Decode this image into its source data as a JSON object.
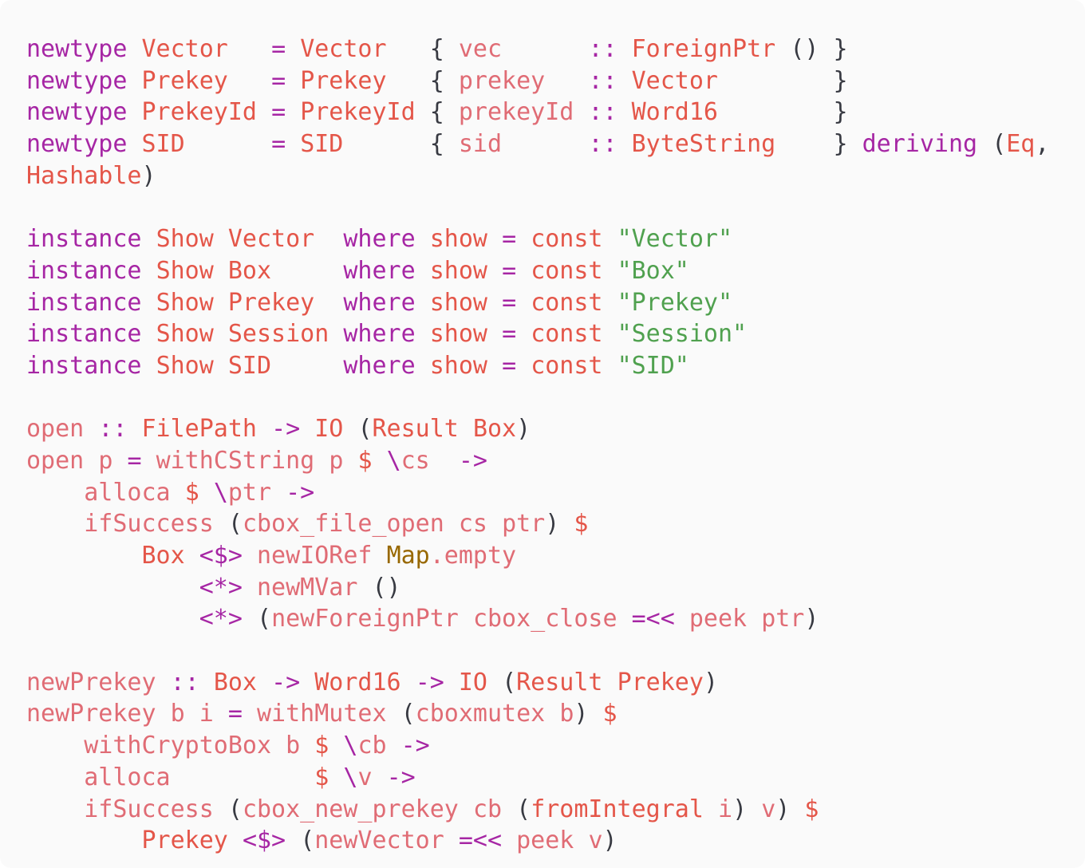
{
  "code": {
    "language": "haskell",
    "lines": [
      [
        [
          "kw",
          "newtype"
        ],
        [
          "txt",
          " "
        ],
        [
          "ty",
          "Vector"
        ],
        [
          "txt",
          "   "
        ],
        [
          "op",
          "="
        ],
        [
          "txt",
          " "
        ],
        [
          "ty",
          "Vector"
        ],
        [
          "txt",
          "   "
        ],
        [
          "pun",
          "{"
        ],
        [
          "txt",
          " "
        ],
        [
          "var",
          "vec"
        ],
        [
          "txt",
          "      "
        ],
        [
          "op",
          "::"
        ],
        [
          "txt",
          " "
        ],
        [
          "ty",
          "ForeignPtr"
        ],
        [
          "txt",
          " "
        ],
        [
          "pun",
          "()"
        ],
        [
          "txt",
          " "
        ],
        [
          "pun",
          "}"
        ]
      ],
      [
        [
          "kw",
          "newtype"
        ],
        [
          "txt",
          " "
        ],
        [
          "ty",
          "Prekey"
        ],
        [
          "txt",
          "   "
        ],
        [
          "op",
          "="
        ],
        [
          "txt",
          " "
        ],
        [
          "ty",
          "Prekey"
        ],
        [
          "txt",
          "   "
        ],
        [
          "pun",
          "{"
        ],
        [
          "txt",
          " "
        ],
        [
          "var",
          "prekey"
        ],
        [
          "txt",
          "   "
        ],
        [
          "op",
          "::"
        ],
        [
          "txt",
          " "
        ],
        [
          "ty",
          "Vector"
        ],
        [
          "txt",
          "        "
        ],
        [
          "pun",
          "}"
        ]
      ],
      [
        [
          "kw",
          "newtype"
        ],
        [
          "txt",
          " "
        ],
        [
          "ty",
          "PrekeyId"
        ],
        [
          "txt",
          " "
        ],
        [
          "op",
          "="
        ],
        [
          "txt",
          " "
        ],
        [
          "ty",
          "PrekeyId"
        ],
        [
          "txt",
          " "
        ],
        [
          "pun",
          "{"
        ],
        [
          "txt",
          " "
        ],
        [
          "var",
          "prekeyId"
        ],
        [
          "txt",
          " "
        ],
        [
          "op",
          "::"
        ],
        [
          "txt",
          " "
        ],
        [
          "ty",
          "Word16"
        ],
        [
          "txt",
          "        "
        ],
        [
          "pun",
          "}"
        ]
      ],
      [
        [
          "kw",
          "newtype"
        ],
        [
          "txt",
          " "
        ],
        [
          "ty",
          "SID"
        ],
        [
          "txt",
          "      "
        ],
        [
          "op",
          "="
        ],
        [
          "txt",
          " "
        ],
        [
          "ty",
          "SID"
        ],
        [
          "txt",
          "      "
        ],
        [
          "pun",
          "{"
        ],
        [
          "txt",
          " "
        ],
        [
          "var",
          "sid"
        ],
        [
          "txt",
          "      "
        ],
        [
          "op",
          "::"
        ],
        [
          "txt",
          " "
        ],
        [
          "ty",
          "ByteString"
        ],
        [
          "txt",
          "    "
        ],
        [
          "pun",
          "}"
        ],
        [
          "txt",
          " "
        ],
        [
          "kw",
          "deriving"
        ],
        [
          "txt",
          " "
        ],
        [
          "pun",
          "("
        ],
        [
          "ty",
          "Eq"
        ],
        [
          "pun",
          ","
        ]
      ],
      [
        [
          "ty",
          "Hashable"
        ],
        [
          "pun",
          ")"
        ]
      ],
      [],
      [
        [
          "kw",
          "instance"
        ],
        [
          "txt",
          " "
        ],
        [
          "ty",
          "Show"
        ],
        [
          "txt",
          " "
        ],
        [
          "ty",
          "Vector"
        ],
        [
          "txt",
          "  "
        ],
        [
          "kw",
          "where"
        ],
        [
          "txt",
          " "
        ],
        [
          "fn",
          "show"
        ],
        [
          "txt",
          " "
        ],
        [
          "op",
          "="
        ],
        [
          "txt",
          " "
        ],
        [
          "fn",
          "const"
        ],
        [
          "txt",
          " "
        ],
        [
          "str",
          "\"Vector\""
        ]
      ],
      [
        [
          "kw",
          "instance"
        ],
        [
          "txt",
          " "
        ],
        [
          "ty",
          "Show"
        ],
        [
          "txt",
          " "
        ],
        [
          "ty",
          "Box"
        ],
        [
          "txt",
          "     "
        ],
        [
          "kw",
          "where"
        ],
        [
          "txt",
          " "
        ],
        [
          "fn",
          "show"
        ],
        [
          "txt",
          " "
        ],
        [
          "op",
          "="
        ],
        [
          "txt",
          " "
        ],
        [
          "fn",
          "const"
        ],
        [
          "txt",
          " "
        ],
        [
          "str",
          "\"Box\""
        ]
      ],
      [
        [
          "kw",
          "instance"
        ],
        [
          "txt",
          " "
        ],
        [
          "ty",
          "Show"
        ],
        [
          "txt",
          " "
        ],
        [
          "ty",
          "Prekey"
        ],
        [
          "txt",
          "  "
        ],
        [
          "kw",
          "where"
        ],
        [
          "txt",
          " "
        ],
        [
          "fn",
          "show"
        ],
        [
          "txt",
          " "
        ],
        [
          "op",
          "="
        ],
        [
          "txt",
          " "
        ],
        [
          "fn",
          "const"
        ],
        [
          "txt",
          " "
        ],
        [
          "str",
          "\"Prekey\""
        ]
      ],
      [
        [
          "kw",
          "instance"
        ],
        [
          "txt",
          " "
        ],
        [
          "ty",
          "Show"
        ],
        [
          "txt",
          " "
        ],
        [
          "ty",
          "Session"
        ],
        [
          "txt",
          " "
        ],
        [
          "kw",
          "where"
        ],
        [
          "txt",
          " "
        ],
        [
          "fn",
          "show"
        ],
        [
          "txt",
          " "
        ],
        [
          "op",
          "="
        ],
        [
          "txt",
          " "
        ],
        [
          "fn",
          "const"
        ],
        [
          "txt",
          " "
        ],
        [
          "str",
          "\"Session\""
        ]
      ],
      [
        [
          "kw",
          "instance"
        ],
        [
          "txt",
          " "
        ],
        [
          "ty",
          "Show"
        ],
        [
          "txt",
          " "
        ],
        [
          "ty",
          "SID"
        ],
        [
          "txt",
          "     "
        ],
        [
          "kw",
          "where"
        ],
        [
          "txt",
          " "
        ],
        [
          "fn",
          "show"
        ],
        [
          "txt",
          " "
        ],
        [
          "op",
          "="
        ],
        [
          "txt",
          " "
        ],
        [
          "fn",
          "const"
        ],
        [
          "txt",
          " "
        ],
        [
          "str",
          "\"SID\""
        ]
      ],
      [],
      [
        [
          "var",
          "open"
        ],
        [
          "txt",
          " "
        ],
        [
          "op",
          "::"
        ],
        [
          "txt",
          " "
        ],
        [
          "ty",
          "FilePath"
        ],
        [
          "txt",
          " "
        ],
        [
          "op",
          "->"
        ],
        [
          "txt",
          " "
        ],
        [
          "ty",
          "IO"
        ],
        [
          "txt",
          " "
        ],
        [
          "pun",
          "("
        ],
        [
          "ty",
          "Result"
        ],
        [
          "txt",
          " "
        ],
        [
          "ty",
          "Box"
        ],
        [
          "pun",
          ")"
        ]
      ],
      [
        [
          "var",
          "open"
        ],
        [
          "txt",
          " "
        ],
        [
          "var",
          "p"
        ],
        [
          "txt",
          " "
        ],
        [
          "op",
          "="
        ],
        [
          "txt",
          " "
        ],
        [
          "var",
          "withCString"
        ],
        [
          "txt",
          " "
        ],
        [
          "var",
          "p"
        ],
        [
          "txt",
          " "
        ],
        [
          "fn",
          "$"
        ],
        [
          "txt",
          " "
        ],
        [
          "op",
          "\\"
        ],
        [
          "var",
          "cs"
        ],
        [
          "txt",
          "  "
        ],
        [
          "op",
          "->"
        ]
      ],
      [
        [
          "txt",
          "    "
        ],
        [
          "var",
          "alloca"
        ],
        [
          "txt",
          " "
        ],
        [
          "fn",
          "$"
        ],
        [
          "txt",
          " "
        ],
        [
          "op",
          "\\"
        ],
        [
          "var",
          "ptr"
        ],
        [
          "txt",
          " "
        ],
        [
          "op",
          "->"
        ]
      ],
      [
        [
          "txt",
          "    "
        ],
        [
          "var",
          "ifSuccess"
        ],
        [
          "txt",
          " "
        ],
        [
          "pun",
          "("
        ],
        [
          "var",
          "cbox_file_open"
        ],
        [
          "txt",
          " "
        ],
        [
          "var",
          "cs"
        ],
        [
          "txt",
          " "
        ],
        [
          "var",
          "ptr"
        ],
        [
          "pun",
          ")"
        ],
        [
          "txt",
          " "
        ],
        [
          "fn",
          "$"
        ]
      ],
      [
        [
          "txt",
          "        "
        ],
        [
          "ty",
          "Box"
        ],
        [
          "txt",
          " "
        ],
        [
          "op",
          "<$>"
        ],
        [
          "txt",
          " "
        ],
        [
          "var",
          "newIORef"
        ],
        [
          "txt",
          " "
        ],
        [
          "mod",
          "Map"
        ],
        [
          "var",
          ".empty"
        ]
      ],
      [
        [
          "txt",
          "            "
        ],
        [
          "op",
          "<*>"
        ],
        [
          "txt",
          " "
        ],
        [
          "var",
          "newMVar"
        ],
        [
          "txt",
          " "
        ],
        [
          "pun",
          "()"
        ]
      ],
      [
        [
          "txt",
          "            "
        ],
        [
          "op",
          "<*>"
        ],
        [
          "txt",
          " "
        ],
        [
          "pun",
          "("
        ],
        [
          "var",
          "newForeignPtr"
        ],
        [
          "txt",
          " "
        ],
        [
          "var",
          "cbox_close"
        ],
        [
          "txt",
          " "
        ],
        [
          "op",
          "=<<"
        ],
        [
          "txt",
          " "
        ],
        [
          "var",
          "peek"
        ],
        [
          "txt",
          " "
        ],
        [
          "var",
          "ptr"
        ],
        [
          "pun",
          ")"
        ]
      ],
      [],
      [
        [
          "var",
          "newPrekey"
        ],
        [
          "txt",
          " "
        ],
        [
          "op",
          "::"
        ],
        [
          "txt",
          " "
        ],
        [
          "ty",
          "Box"
        ],
        [
          "txt",
          " "
        ],
        [
          "op",
          "->"
        ],
        [
          "txt",
          " "
        ],
        [
          "ty",
          "Word16"
        ],
        [
          "txt",
          " "
        ],
        [
          "op",
          "->"
        ],
        [
          "txt",
          " "
        ],
        [
          "ty",
          "IO"
        ],
        [
          "txt",
          " "
        ],
        [
          "pun",
          "("
        ],
        [
          "ty",
          "Result"
        ],
        [
          "txt",
          " "
        ],
        [
          "ty",
          "Prekey"
        ],
        [
          "pun",
          ")"
        ]
      ],
      [
        [
          "var",
          "newPrekey"
        ],
        [
          "txt",
          " "
        ],
        [
          "var",
          "b"
        ],
        [
          "txt",
          " "
        ],
        [
          "var",
          "i"
        ],
        [
          "txt",
          " "
        ],
        [
          "op",
          "="
        ],
        [
          "txt",
          " "
        ],
        [
          "var",
          "withMutex"
        ],
        [
          "txt",
          " "
        ],
        [
          "pun",
          "("
        ],
        [
          "var",
          "cboxmutex"
        ],
        [
          "txt",
          " "
        ],
        [
          "var",
          "b"
        ],
        [
          "pun",
          ")"
        ],
        [
          "txt",
          " "
        ],
        [
          "fn",
          "$"
        ]
      ],
      [
        [
          "txt",
          "    "
        ],
        [
          "var",
          "withCryptoBox"
        ],
        [
          "txt",
          " "
        ],
        [
          "var",
          "b"
        ],
        [
          "txt",
          " "
        ],
        [
          "fn",
          "$"
        ],
        [
          "txt",
          " "
        ],
        [
          "op",
          "\\"
        ],
        [
          "var",
          "cb"
        ],
        [
          "txt",
          " "
        ],
        [
          "op",
          "->"
        ]
      ],
      [
        [
          "txt",
          "    "
        ],
        [
          "var",
          "alloca"
        ],
        [
          "txt",
          "          "
        ],
        [
          "fn",
          "$"
        ],
        [
          "txt",
          " "
        ],
        [
          "op",
          "\\"
        ],
        [
          "var",
          "v"
        ],
        [
          "txt",
          " "
        ],
        [
          "op",
          "->"
        ]
      ],
      [
        [
          "txt",
          "    "
        ],
        [
          "var",
          "ifSuccess"
        ],
        [
          "txt",
          " "
        ],
        [
          "pun",
          "("
        ],
        [
          "var",
          "cbox_new_prekey"
        ],
        [
          "txt",
          " "
        ],
        [
          "var",
          "cb"
        ],
        [
          "txt",
          " "
        ],
        [
          "pun",
          "("
        ],
        [
          "ty",
          "fromIntegral"
        ],
        [
          "txt",
          " "
        ],
        [
          "var",
          "i"
        ],
        [
          "pun",
          ")"
        ],
        [
          "txt",
          " "
        ],
        [
          "var",
          "v"
        ],
        [
          "pun",
          ")"
        ],
        [
          "txt",
          " "
        ],
        [
          "fn",
          "$"
        ]
      ],
      [
        [
          "txt",
          "        "
        ],
        [
          "ty",
          "Prekey"
        ],
        [
          "txt",
          " "
        ],
        [
          "op",
          "<$>"
        ],
        [
          "txt",
          " "
        ],
        [
          "pun",
          "("
        ],
        [
          "var",
          "newVector"
        ],
        [
          "txt",
          " "
        ],
        [
          "op",
          "=<<"
        ],
        [
          "txt",
          " "
        ],
        [
          "var",
          "peek"
        ],
        [
          "txt",
          " "
        ],
        [
          "var",
          "v"
        ],
        [
          "pun",
          ")"
        ]
      ]
    ]
  }
}
